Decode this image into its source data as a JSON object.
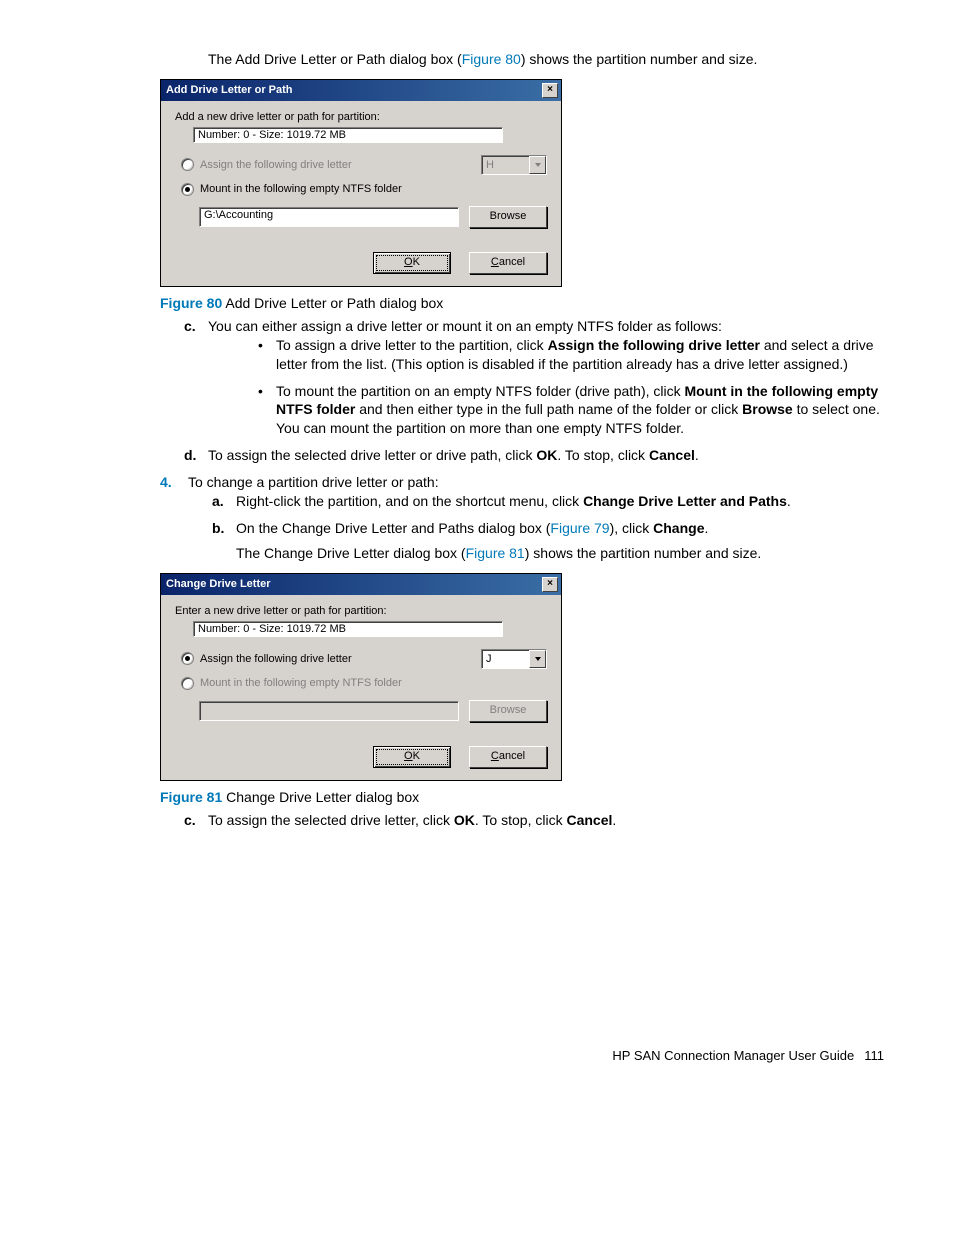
{
  "intro_sentence_prefix": "The Add Drive Letter or Path dialog box (",
  "intro_link1": "Figure 80",
  "intro_sentence_suffix": ") shows the partition number and size.",
  "dialog1": {
    "title": "Add Drive Letter or Path",
    "prompt": "Add a new drive letter or path for partition:",
    "partition_info": "Number: 0 - Size: 1019.72 MB",
    "radio_assign_label": "Assign the following drive letter",
    "assign_selected": false,
    "drive_letter": "H",
    "radio_mount_label": "Mount in the following empty NTFS folder",
    "mount_selected": true,
    "path_value": "G:\\Accounting",
    "browse_label": "Browse",
    "ok_label": "OK",
    "cancel_label": "Cancel"
  },
  "fig80_num": "Figure 80",
  "fig80_caption": " Add Drive Letter or Path dialog box",
  "step_c_text": "You can either assign a drive letter or mount it on an empty NTFS folder as follows:",
  "bullet1_prefix": "To assign a drive letter to the partition, click ",
  "bullet1_bold": "Assign the following drive letter",
  "bullet1_suffix": " and select a drive letter from the list. (This option is disabled if the partition already has a drive letter assigned.)",
  "bullet2_prefix": "To mount the partition on an empty NTFS folder (drive path), click ",
  "bullet2_bold1": "Mount in the following empty NTFS folder",
  "bullet2_mid": " and then either type in the full path name of the folder or click ",
  "bullet2_bold2": "Browse",
  "bullet2_suffix": " to select one. You can mount the partition on more than one empty NTFS folder.",
  "step_d_prefix": "To assign the selected drive letter or drive path, click ",
  "step_d_bold1": "OK",
  "step_d_mid": ". To stop, click ",
  "step_d_bold2": "Cancel",
  "step_d_suffix": ".",
  "step4_text": "To change a partition drive letter or path:",
  "step4a_prefix": "Right-click the partition, and on the shortcut menu, click ",
  "step4a_bold": "Change Drive Letter and Paths",
  "step4a_suffix": ".",
  "step4b_prefix": "On the Change Drive Letter and Paths dialog box (",
  "step4b_link": "Figure 79",
  "step4b_mid": "), click ",
  "step4b_bold": "Change",
  "step4b_suffix": ".",
  "step4b_line2_prefix": "The Change Drive Letter dialog box (",
  "step4b_line2_link": "Figure 81",
  "step4b_line2_suffix": ") shows the partition number and size.",
  "dialog2": {
    "title": "Change Drive Letter",
    "prompt": "Enter a new drive letter or path for partition:",
    "partition_info": "Number: 0 - Size: 1019.72 MB",
    "radio_assign_label": "Assign the following drive letter",
    "assign_selected": true,
    "drive_letter": "J",
    "radio_mount_label": "Mount in the following empty NTFS folder",
    "mount_selected": false,
    "path_value": "",
    "browse_label": "Browse",
    "ok_label": "OK",
    "cancel_label": "Cancel"
  },
  "fig81_num": "Figure 81",
  "fig81_caption": " Change Drive Letter dialog box",
  "step4c_prefix": "To assign the selected drive letter, click ",
  "step4c_bold1": "OK",
  "step4c_mid": ". To stop, click ",
  "step4c_bold2": "Cancel",
  "step4c_suffix": ".",
  "footer_text": "HP SAN Connection Manager User Guide",
  "page_number": "111"
}
